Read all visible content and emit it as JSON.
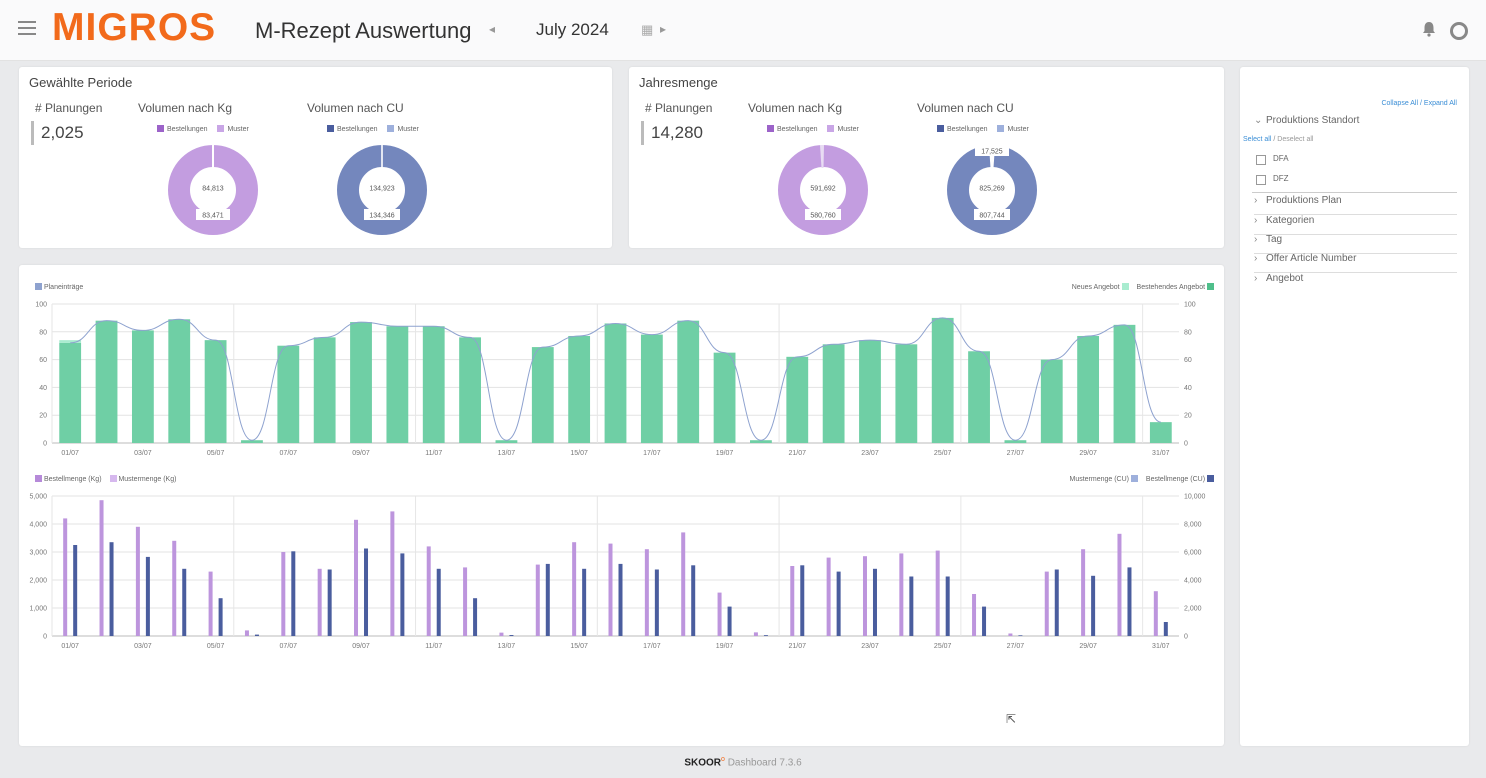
{
  "header": {
    "logo": "MIGROS",
    "title": "M-Rezept Auswertung",
    "period": "July 2024",
    "prev_glyph": "◂",
    "next_glyph": "▸",
    "calendar_glyph": "▦"
  },
  "period_card": {
    "title": "Gewählte Periode",
    "planungen_label": "# Planungen",
    "planungen_value": "2,025",
    "kg": {
      "title": "Volumen nach Kg",
      "legend": [
        "Bestellungen",
        "Muster"
      ],
      "inner_label": "84,813",
      "outer_label": "83,471",
      "values": {
        "Bestellungen": 83471,
        "Muster": 1342
      }
    },
    "cu": {
      "title": "Volumen nach CU",
      "legend": [
        "Bestellungen",
        "Muster"
      ],
      "inner_label": "134,923",
      "outer_label": "134,346",
      "values": {
        "Bestellungen": 134346,
        "Muster": 577
      }
    }
  },
  "year_card": {
    "title": "Jahresmenge",
    "planungen_label": "# Planungen",
    "planungen_value": "14,280",
    "kg": {
      "title": "Volumen nach Kg",
      "legend": [
        "Bestellungen",
        "Muster"
      ],
      "inner_label": "591,692",
      "outer_label": "580,760",
      "values": {
        "Bestellungen": 580760,
        "Muster": 10932
      }
    },
    "cu": {
      "title": "Volumen nach CU",
      "legend": [
        "Bestellungen",
        "Muster"
      ],
      "top_label": "17,525",
      "inner_label": "825,269",
      "outer_label": "807,744",
      "values": {
        "Bestellungen": 807744,
        "Muster": 17525
      }
    }
  },
  "colors": {
    "purple": "#bd95dd",
    "purple_dark": "#9c63c9",
    "blue": "#7a8cbf",
    "blue_dark": "#4a5d9e",
    "teal": "#6fcfa5",
    "teal_light": "#a9ecd0",
    "line": "#8ea2cf"
  },
  "sidebar": {
    "collapse_all": "Collapse All",
    "separator": "/",
    "expand_all": "Expand All",
    "select_all": "Select all",
    "deselect_all": "Deselect all",
    "sections": [
      {
        "label": "Produktions Standort",
        "expanded": true
      },
      {
        "label": "Produktions Plan",
        "expanded": false
      },
      {
        "label": "Kategorien",
        "expanded": false
      },
      {
        "label": "Tag",
        "expanded": false
      },
      {
        "label": "Offer Article Number",
        "expanded": false
      },
      {
        "label": "Angebot",
        "expanded": false
      }
    ],
    "options": [
      "DFA",
      "DFZ"
    ]
  },
  "chart_data": [
    {
      "type": "bar",
      "legend_left": "Planeinträge",
      "legend_right": [
        "Neues Angebot",
        "Bestehendes Angebot"
      ],
      "categories": [
        "01/07",
        "02/07",
        "03/07",
        "04/07",
        "05/07",
        "06/07",
        "07/07",
        "08/07",
        "09/07",
        "10/07",
        "11/07",
        "12/07",
        "13/07",
        "14/07",
        "15/07",
        "16/07",
        "17/07",
        "18/07",
        "19/07",
        "20/07",
        "21/07",
        "22/07",
        "23/07",
        "24/07",
        "25/07",
        "26/07",
        "27/07",
        "28/07",
        "29/07",
        "30/07",
        "31/07"
      ],
      "tick_labels": [
        "01/07",
        "03/07",
        "05/07",
        "07/07",
        "09/07",
        "11/07",
        "13/07",
        "15/07",
        "17/07",
        "19/07",
        "21/07",
        "23/07",
        "25/07",
        "27/07",
        "29/07",
        "31/07"
      ],
      "ylim": [
        0,
        100
      ],
      "yticks": [
        "0",
        "20",
        "40",
        "60",
        "80",
        "100"
      ],
      "series": [
        {
          "name": "Bestehendes Angebot",
          "values": [
            72,
            88,
            81,
            89,
            74,
            2,
            70,
            76,
            87,
            84,
            84,
            76,
            2,
            69,
            77,
            86,
            78,
            88,
            65,
            2,
            62,
            71,
            74,
            71,
            90,
            66,
            2,
            60,
            77,
            85,
            15
          ]
        },
        {
          "name": "Neues Angebot",
          "values": [
            2,
            0,
            0,
            0,
            0,
            0,
            0,
            0,
            0,
            0,
            0,
            0,
            0,
            0,
            0,
            0,
            0,
            0,
            0,
            0,
            0,
            0,
            0,
            0,
            0,
            0,
            0,
            0,
            0,
            0,
            0
          ]
        },
        {
          "name": "Planeinträge",
          "values": [
            72,
            88,
            81,
            89,
            74,
            2,
            70,
            76,
            87,
            84,
            84,
            76,
            2,
            69,
            77,
            86,
            78,
            88,
            65,
            2,
            62,
            71,
            74,
            71,
            90,
            66,
            2,
            60,
            77,
            85,
            15
          ]
        }
      ]
    },
    {
      "type": "bar",
      "legend_left": [
        "Bestellmenge (Kg)",
        "Mustermenge (Kg)"
      ],
      "legend_right": [
        "Mustermenge (CU)",
        "Bestellmenge (CU)"
      ],
      "categories": [
        "01/07",
        "02/07",
        "03/07",
        "04/07",
        "05/07",
        "06/07",
        "07/07",
        "08/07",
        "09/07",
        "10/07",
        "11/07",
        "12/07",
        "13/07",
        "14/07",
        "15/07",
        "16/07",
        "17/07",
        "18/07",
        "19/07",
        "20/07",
        "21/07",
        "22/07",
        "23/07",
        "24/07",
        "25/07",
        "26/07",
        "27/07",
        "28/07",
        "29/07",
        "30/07",
        "31/07"
      ],
      "tick_labels": [
        "01/07",
        "03/07",
        "05/07",
        "07/07",
        "09/07",
        "11/07",
        "13/07",
        "15/07",
        "17/07",
        "19/07",
        "21/07",
        "23/07",
        "25/07",
        "27/07",
        "29/07",
        "31/07"
      ],
      "ylim_left": [
        0,
        5000
      ],
      "ylim_right": [
        0,
        10000
      ],
      "yticks_left": [
        "0",
        "1,000",
        "2,000",
        "3,000",
        "4,000",
        "5,000"
      ],
      "yticks_right": [
        "0",
        "2,000",
        "4,000",
        "6,000",
        "8,000",
        "10,000"
      ],
      "series": [
        {
          "name": "Bestellmenge (Kg)",
          "axis": "left",
          "values": [
            4200,
            4850,
            3900,
            3400,
            2300,
            200,
            3000,
            2400,
            4150,
            4450,
            3200,
            2450,
            120,
            2550,
            3350,
            3300,
            3100,
            3700,
            1550,
            130,
            2500,
            2800,
            2850,
            2950,
            3050,
            1500,
            90,
            2300,
            3100,
            3650,
            1600
          ]
        },
        {
          "name": "Bestellmenge (CU)",
          "axis": "right",
          "values": [
            6500,
            6700,
            5650,
            4800,
            2700,
            100,
            6050,
            4750,
            6250,
            5900,
            4800,
            2700,
            70,
            5150,
            4800,
            5150,
            4750,
            5050,
            2100,
            60,
            5050,
            4600,
            4800,
            4250,
            4250,
            2100,
            50,
            4750,
            4300,
            4900,
            1000
          ]
        }
      ]
    }
  ],
  "footer": {
    "brand": "SKOOR",
    "product": "Dashboard",
    "version": "7.3.6"
  }
}
